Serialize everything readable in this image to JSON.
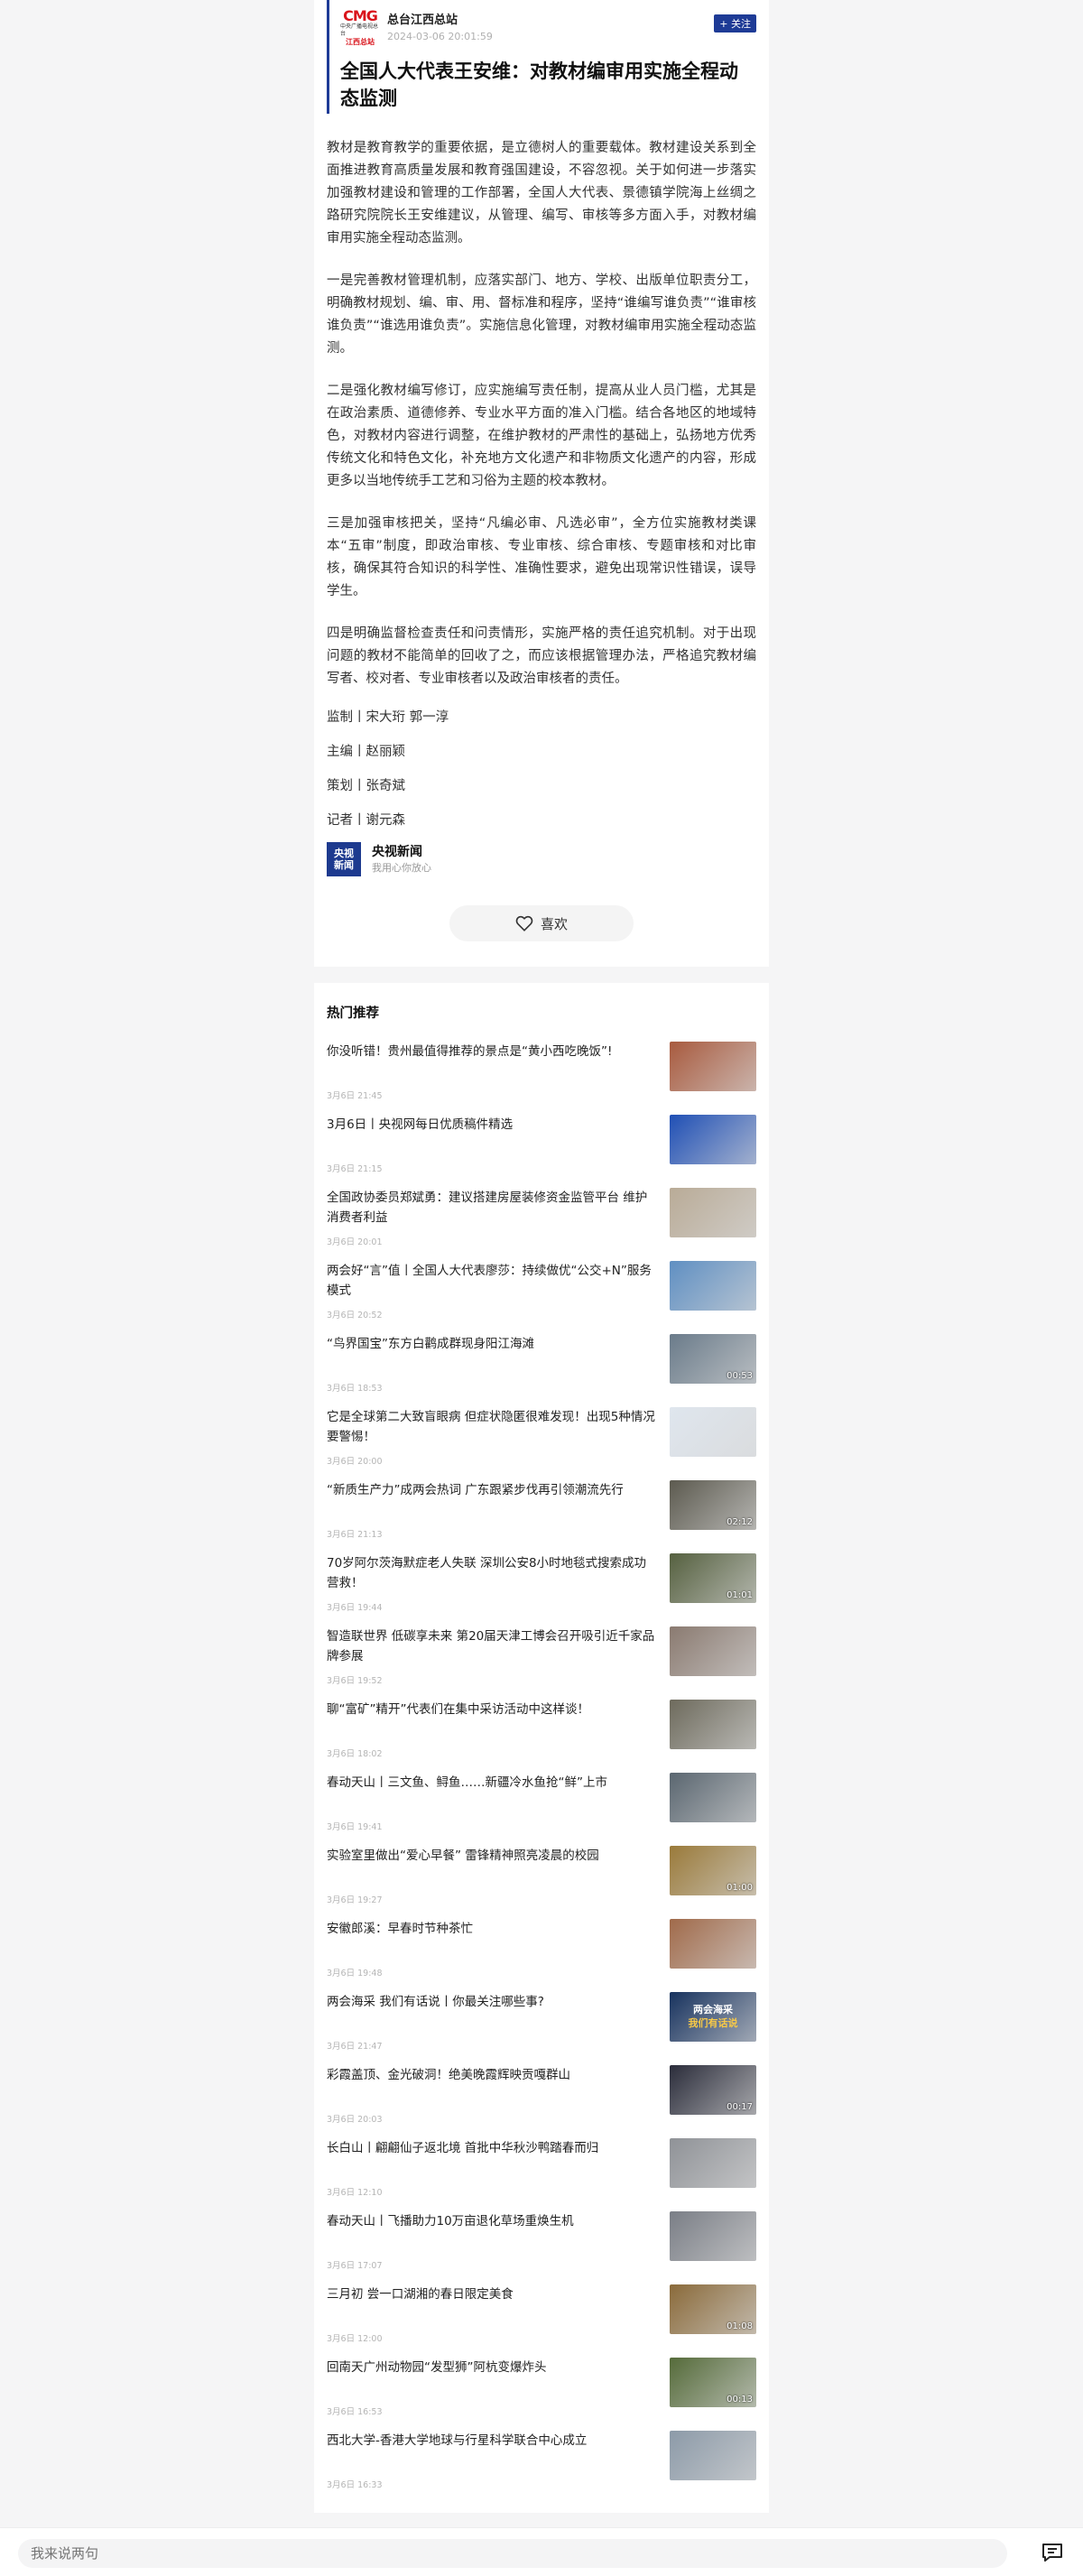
{
  "source": {
    "logo": {
      "brand": "CMG",
      "line1": "中央广播电视总台",
      "line2": "江西总站"
    },
    "name": "总台江西总站",
    "time": "2024-03-06 20:01:59",
    "follow_label": "+ 关注"
  },
  "article": {
    "title": "全国人大代表王安维：对教材编审用实施全程动态监测",
    "paragraphs": [
      "教材是教育教学的重要依据，是立德树人的重要载体。教材建设关系到全面推进教育高质量发展和教育强国建设，不容忽视。关于如何进一步落实加强教材建设和管理的工作部署，全国人大代表、景德镇学院海上丝绸之路研究院院长王安维建议，从管理、编写、审核等多方面入手，对教材编审用实施全程动态监测。",
      "一是完善教材管理机制，应落实部门、地方、学校、出版单位职责分工，明确教材规划、编、审、用、督标准和程序，坚持“谁编写谁负责”“谁审核谁负责”“谁选用谁负责”。实施信息化管理，对教材编审用实施全程动态监测。",
      "二是强化教材编写修订，应实施编写责任制，提高从业人员门槛，尤其是在政治素质、道德修养、专业水平方面的准入门槛。结合各地区的地域特色，对教材内容进行调整，在维护教材的严肃性的基础上，弘扬地方优秀传统文化和特色文化，补充地方文化遗产和非物质文化遗产的内容，形成更多以当地传统手工艺和习俗为主题的校本教材。",
      "三是加强审核把关，坚持“凡编必审、凡选必审”，全方位实施教材类课本“五审”制度，即政治审核、专业审核、综合审核、专题审核和对比审核，确保其符合知识的科学性、准确性要求，避免出现常识性错误，误导学生。",
      "四是明确监督检查责任和问责情形，实施严格的责任追究机制。对于出现问题的教材不能简单的回收了之，而应该根据管理办法，严格追究教材编写者、校对者、专业审核者以及政治审核者的责任。"
    ],
    "credits": [
      "监制丨宋大珩 郭一淳",
      "主编丨赵丽颖",
      "策划丨张奇斌",
      "记者丨谢元森"
    ],
    "author": {
      "logo_line1": "央视",
      "logo_line2": "新闻",
      "name": "央视新闻",
      "slogan": "我用心你放心"
    },
    "like_label": "喜欢"
  },
  "recommend": {
    "heading": "热门推荐",
    "items": [
      {
        "title": "你没听错！贵州最值得推荐的景点是“黄小西吃晚饭”!",
        "time": "3月6日 21:45",
        "duration": "",
        "thumb_color": "#a85a3e"
      },
      {
        "title": "3月6日丨央视网每日优质稿件精选",
        "time": "3月6日 21:15",
        "duration": "",
        "thumb_color": "#1f4fb5"
      },
      {
        "title": "全国政协委员郑斌勇：建议搭建房屋装修资金监管平台 维护消费者利益",
        "time": "3月6日 20:01",
        "duration": "",
        "thumb_color": "#b9ab97"
      },
      {
        "title": "两会好“言”值丨全国人大代表廖莎：持续做优“公交+N”服务模式",
        "time": "3月6日 20:52",
        "duration": "",
        "thumb_color": "#5f8fc2"
      },
      {
        "title": "“鸟界国宝”东方白鹳成群现身阳江海滩",
        "time": "3月6日 18:53",
        "duration": "00:53",
        "thumb_color": "#6a7b8a"
      },
      {
        "title": "它是全球第二大致盲眼病 但症状隐匿很难发现！出现5种情况要警惕！",
        "time": "3月6日 20:00",
        "duration": "",
        "thumb_color": "#dfe6ee"
      },
      {
        "title": "“新质生产力”成两会热词 广东跟紧步伐再引领潮流先行",
        "time": "3月6日 21:13",
        "duration": "02:12",
        "thumb_color": "#5c5a4f"
      },
      {
        "title": "70岁阿尔茨海默症老人失联 深圳公安8小时地毯式搜索成功营救！",
        "time": "3月6日 19:44",
        "duration": "01:01",
        "thumb_color": "#55603f"
      },
      {
        "title": "智造联世界 低碳享未来 第20届天津工博会召开吸引近千家品牌参展",
        "time": "3月6日 19:52",
        "duration": "",
        "thumb_color": "#8a7a70"
      },
      {
        "title": "聊“富矿”精开”代表们在集中采访活动中这样谈！",
        "time": "3月6日 18:02",
        "duration": "",
        "thumb_color": "#6d6a5c"
      },
      {
        "title": "春动天山丨三文鱼、鲟鱼……新疆冷水鱼抢“鲜”上市",
        "time": "3月6日 19:41",
        "duration": "",
        "thumb_color": "#5a6670"
      },
      {
        "title": "实验室里做出“爱心早餐” 雷锋精神照亮凌晨的校园",
        "time": "3月6日 19:27",
        "duration": "01:00",
        "thumb_color": "#9a7a3a"
      },
      {
        "title": "安徽郎溪：早春时节种茶忙",
        "time": "3月6日 19:48",
        "duration": "",
        "thumb_color": "#a06a4a"
      },
      {
        "title": "两会海采 我们有话说丨你最关注哪些事?",
        "time": "3月6日 21:47",
        "duration": "",
        "thumb_color": "#17325e",
        "thumb_text1": "两会海采",
        "thumb_text2": "我们有话说"
      },
      {
        "title": "彩霞盖顶、金光破洞！绝美晚霞辉映贡嘎群山",
        "time": "3月6日 20:03",
        "duration": "00:17",
        "thumb_color": "#2a2c3a"
      },
      {
        "title": "长白山丨翩翩仙子返北境 首批中华秋沙鸭踏春而归",
        "time": "3月6日 12:10",
        "duration": "",
        "thumb_color": "#8f9297"
      },
      {
        "title": "春动天山丨飞播助力10万亩退化草场重焕生机",
        "time": "3月6日 17:07",
        "duration": "",
        "thumb_color": "#7a7e86"
      },
      {
        "title": "三月初 尝一口湖湘的春日限定美食",
        "time": "3月6日 12:00",
        "duration": "01:08",
        "thumb_color": "#8a6a3a"
      },
      {
        "title": "回南天广州动物园“发型狮”阿杭变爆炸头",
        "time": "3月6日 16:53",
        "duration": "00:13",
        "thumb_color": "#556b3a"
      },
      {
        "title": "西北大学-香港大学地球与行星科学联合中心成立",
        "time": "3月6日 16:33",
        "duration": "",
        "thumb_color": "#8c9aa8"
      }
    ]
  },
  "comment": {
    "placeholder": "我来说两句"
  }
}
